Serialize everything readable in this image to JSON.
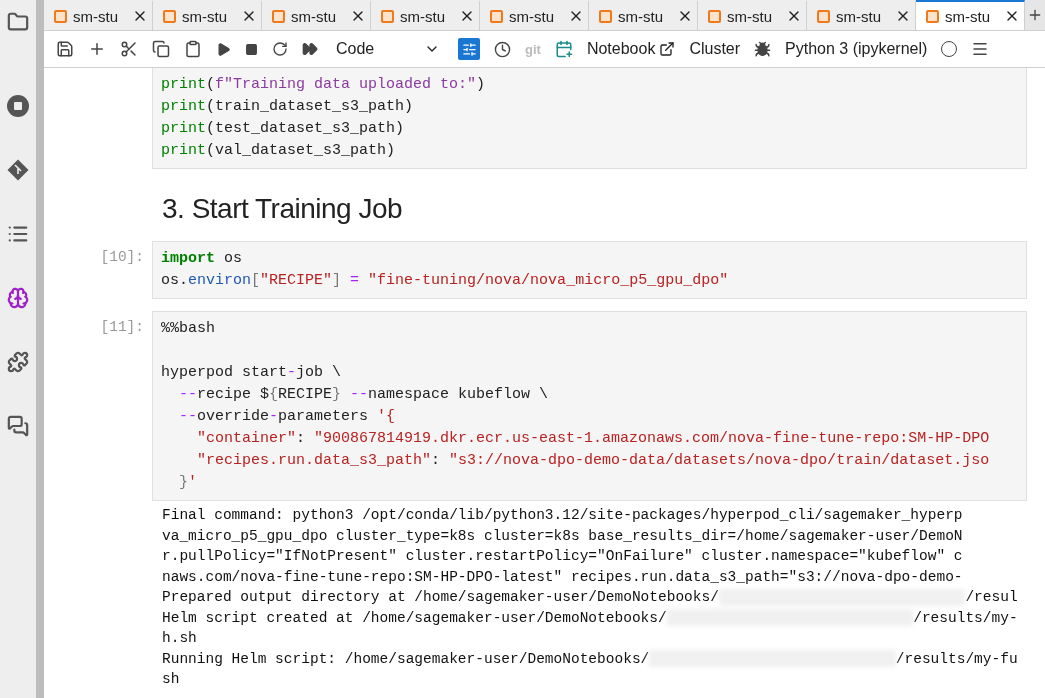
{
  "sidebar": {
    "items": [
      {
        "selected": false
      },
      {
        "selected": false
      },
      {
        "selected": false
      },
      {
        "selected": false
      },
      {
        "selected": true
      },
      {
        "selected": false
      },
      {
        "selected": false
      }
    ]
  },
  "tabs": [
    {
      "label": "sm-stu",
      "selected": false
    },
    {
      "label": "sm-stu",
      "selected": false
    },
    {
      "label": "sm-stu",
      "selected": false
    },
    {
      "label": "sm-stu",
      "selected": false
    },
    {
      "label": "sm-stu",
      "selected": false
    },
    {
      "label": "sm-stu",
      "selected": false
    },
    {
      "label": "sm-stu",
      "selected": false
    },
    {
      "label": "sm-stu",
      "selected": false
    },
    {
      "label": "sm-stu",
      "selected": true
    }
  ],
  "toolbar": {
    "cell_type": "Code",
    "inspector_on": true,
    "git": "git",
    "git_disabled": true,
    "notebook": "Notebook",
    "cluster": "Cluster",
    "kernel": "Python 3 (ipykernel)",
    "kernel_busy": false
  },
  "cells": [
    {
      "kind": "code",
      "lines": [
        {
          "kind": "code",
          "tokens": [
            {
              "kind": "builtin",
              "text": "print"
            },
            {
              "kind": "plain",
              "text": "("
            },
            {
              "kind": "fstring",
              "text": "f\"Training data uploaded to:\""
            },
            {
              "kind": "plain",
              "text": ")"
            }
          ]
        },
        {
          "kind": "code",
          "tokens": [
            {
              "kind": "builtin",
              "text": "print"
            },
            {
              "kind": "plain",
              "text": "(train_dataset_s3_path)"
            }
          ]
        },
        {
          "kind": "code",
          "tokens": [
            {
              "kind": "builtin",
              "text": "print"
            },
            {
              "kind": "plain",
              "text": "(test_dataset_s3_path)"
            }
          ]
        },
        {
          "kind": "code",
          "tokens": [
            {
              "kind": "builtin",
              "text": "print"
            },
            {
              "kind": "plain",
              "text": "(val_dataset_s3_path)"
            }
          ]
        }
      ]
    },
    {
      "kind": "heading",
      "text": "3. Start Training Job"
    },
    {
      "kind": "code",
      "prompt": "[10]:",
      "lines": [
        {
          "kind": "code",
          "tokens": [
            {
              "kind": "keyword",
              "text": "import"
            },
            {
              "kind": "plain",
              "text": " os"
            }
          ]
        },
        {
          "kind": "code",
          "tokens": [
            {
              "kind": "plain",
              "text": "os."
            },
            {
              "kind": "attr",
              "text": "environ"
            },
            {
              "kind": "bracket",
              "text": "["
            },
            {
              "kind": "string",
              "text": "\"RECIPE\""
            },
            {
              "kind": "bracket",
              "text": "]"
            },
            {
              "kind": "operator",
              "text": " = "
            },
            {
              "kind": "string",
              "text": "\"fine-tuning/nova/nova_micro_p5_gpu_dpo\""
            }
          ]
        }
      ]
    },
    {
      "kind": "code",
      "prompt": "[11]:",
      "lines": [
        {
          "kind": "code",
          "tokens": [
            {
              "kind": "plain",
              "text": "%%bash"
            }
          ]
        },
        {
          "kind": "blank"
        },
        {
          "kind": "code",
          "tokens": [
            {
              "kind": "plain",
              "text": "hyperpod start"
            },
            {
              "kind": "operator",
              "text": "-"
            },
            {
              "kind": "plain",
              "text": "job \\"
            }
          ]
        },
        {
          "kind": "code",
          "tokens": [
            {
              "kind": "operator",
              "text": "  --"
            },
            {
              "kind": "plain",
              "text": "recipe $"
            },
            {
              "kind": "bracket",
              "text": "{"
            },
            {
              "kind": "plain",
              "text": "RECIPE"
            },
            {
              "kind": "bracket",
              "text": "}"
            },
            {
              "kind": "operator",
              "text": " --"
            },
            {
              "kind": "plain",
              "text": "namespace kubeflow \\"
            }
          ]
        },
        {
          "kind": "code",
          "tokens": [
            {
              "kind": "operator",
              "text": "  --"
            },
            {
              "kind": "plain",
              "text": "override"
            },
            {
              "kind": "operator",
              "text": "-"
            },
            {
              "kind": "plain",
              "text": "parameters "
            },
            {
              "kind": "string",
              "text": "'{"
            }
          ]
        },
        {
          "kind": "code",
          "tokens": [
            {
              "kind": "string",
              "text": "    \"container\""
            },
            {
              "kind": "plain",
              "text": ": "
            },
            {
              "kind": "string",
              "text": "\"900867814919.dkr.ecr.us-east-1.amazonaws.com/nova-fine-tune-repo:SM-HP-DPO"
            }
          ]
        },
        {
          "kind": "code",
          "tokens": [
            {
              "kind": "string",
              "text": "    \"recipes.run.data_s3_path\""
            },
            {
              "kind": "plain",
              "text": ": "
            },
            {
              "kind": "string",
              "text": "\"s3://nova-dpo-demo-data/datasets/nova-dpo/train/dataset.jso"
            }
          ]
        },
        {
          "kind": "code",
          "tokens": [
            {
              "kind": "bracket",
              "text": "  }"
            },
            {
              "kind": "string",
              "text": "'"
            }
          ]
        }
      ],
      "output": [
        [
          {
            "kind": "text",
            "text": "Final command: python3 /opt/conda/lib/python3.12/site-packages/hyperpod_cli/sagemaker_hyperp"
          }
        ],
        [
          {
            "kind": "text",
            "text": "va_micro_p5_gpu_dpo cluster_type=k8s cluster=k8s base_results_dir=/home/sagemaker-user/DemoN"
          }
        ],
        [
          {
            "kind": "text",
            "text": "r.pullPolicy=\"IfNotPresent\" cluster.restartPolicy=\"OnFailure\" cluster.namespace=\"kubeflow\" c"
          }
        ],
        [
          {
            "kind": "text",
            "text": "naws.com/nova-fine-tune-repo:SM-HP-DPO-latest\" recipes.run.data_s3_path=\"s3://nova-dpo-demo-"
          }
        ],
        [
          {
            "kind": "text",
            "text": "Prepared output directory at /home/sagemaker-user/DemoNotebooks/"
          },
          {
            "kind": "redacted"
          },
          {
            "kind": "text",
            "text": "/resul"
          }
        ],
        [
          {
            "kind": "text",
            "text": "Helm script created at /home/sagemaker-user/DemoNotebooks/"
          },
          {
            "kind": "redacted"
          },
          {
            "kind": "text",
            "text": "/results/my-"
          }
        ],
        [
          {
            "kind": "text",
            "text": "h.sh"
          }
        ],
        [
          {
            "kind": "text",
            "text": "Running Helm script: /home/sagemaker-user/DemoNotebooks/"
          },
          {
            "kind": "redacted"
          },
          {
            "kind": "text",
            "text": "/results/my-fu"
          }
        ],
        [
          {
            "kind": "text",
            "text": "sh"
          }
        ]
      ]
    }
  ]
}
